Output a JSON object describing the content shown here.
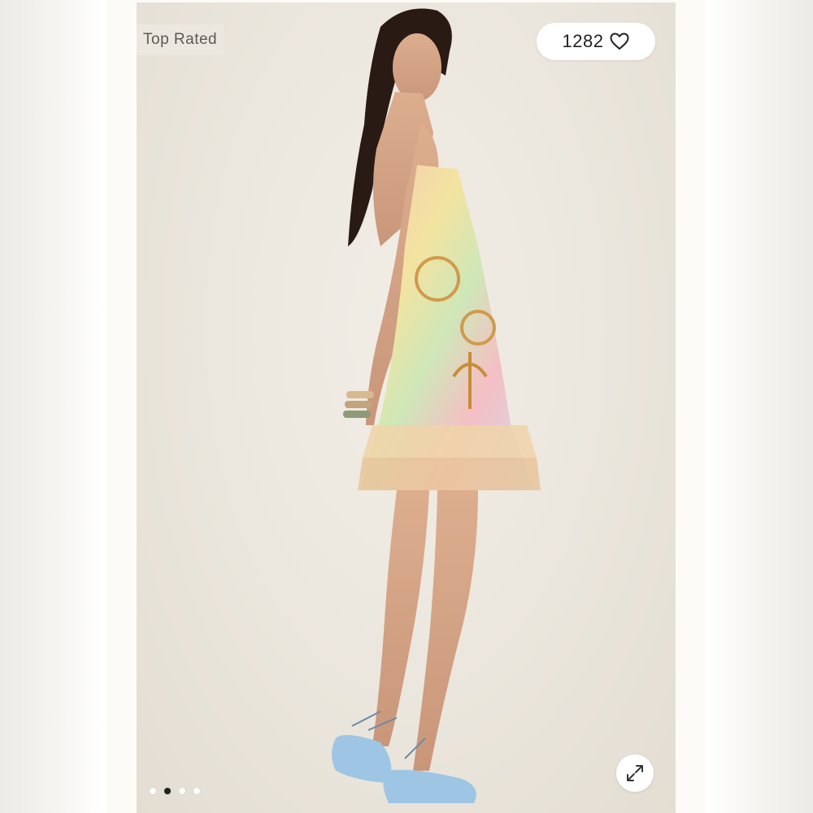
{
  "badge": {
    "label": "Top Rated"
  },
  "likes": {
    "count": "1282",
    "icon": "heart-outline-icon"
  },
  "expand": {
    "icon": "expand-diagonal-icon"
  },
  "carousel": {
    "total": 4,
    "active_index": 1
  },
  "colors": {
    "backdrop": "#ebe6dd",
    "pill_bg": "#ffffff",
    "active_dot": "#222222"
  }
}
